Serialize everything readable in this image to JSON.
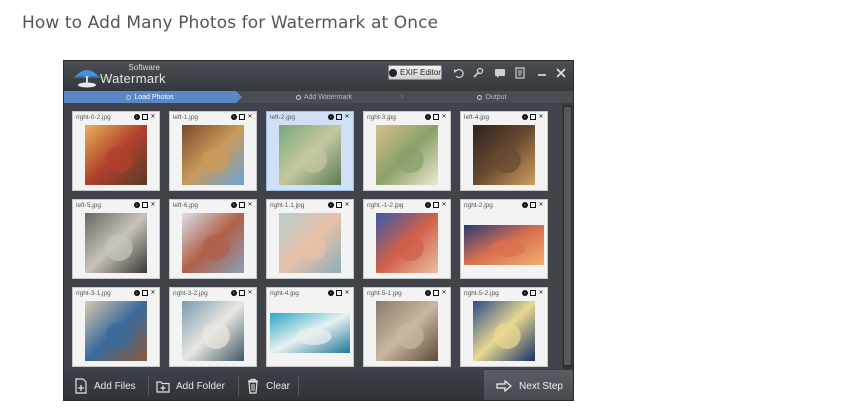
{
  "page": {
    "heading": "How to Add Many Photos for Watermark at Once"
  },
  "app": {
    "logo_small": "Software",
    "logo_big": "Watermark",
    "exif_label": "EXIF Editor",
    "titlebar_icons": [
      "undo-icon",
      "wrench-icon",
      "chat-icon",
      "document-icon",
      "minimize-icon",
      "close-icon"
    ],
    "steps": [
      {
        "label": "Load Photos",
        "active": true
      },
      {
        "label": "Add Watermark",
        "active": false
      },
      {
        "label": "Output",
        "active": false
      }
    ],
    "photos": [
      {
        "name": "right-0-2.jpg",
        "colors": [
          "#e8b25a",
          "#b0402c",
          "#5a3a2a"
        ],
        "selected": false
      },
      {
        "name": "left-1.jpg",
        "colors": [
          "#7a4a2a",
          "#c99a5a",
          "#6aa3d8"
        ],
        "selected": false
      },
      {
        "name": "left-2.jpg",
        "colors": [
          "#7aa87a",
          "#c4c8a0",
          "#5a7a5a"
        ],
        "selected": true
      },
      {
        "name": "right-3.jpg",
        "colors": [
          "#d8c08a",
          "#8aa06a",
          "#f0e8d0"
        ],
        "selected": false
      },
      {
        "name": "left-4.jpg",
        "colors": [
          "#2a2420",
          "#6a4a30",
          "#d0a060"
        ],
        "selected": false
      },
      {
        "name": "left-5.jpg",
        "colors": [
          "#6a6660",
          "#c8c4bc",
          "#3a3632"
        ],
        "selected": false
      },
      {
        "name": "left-6.jpg",
        "colors": [
          "#d8e0e8",
          "#b06048",
          "#88a0b8"
        ],
        "selected": false
      },
      {
        "name": "right-1.1.jpg",
        "colors": [
          "#b8ccd0",
          "#e8c0a8",
          "#8ab0b8"
        ],
        "selected": false
      },
      {
        "name": "right.-1-2.jpg",
        "colors": [
          "#3a5aa8",
          "#d06048",
          "#e8c0a0"
        ],
        "selected": false
      },
      {
        "name": "right-2.jpg",
        "colors": [
          "#2a3a78",
          "#d87050",
          "#f0b070"
        ],
        "selected": false
      },
      {
        "name": "right-3-1.jpg",
        "colors": [
          "#d8c8b0",
          "#3a6a9a",
          "#8a5a3a"
        ],
        "selected": false
      },
      {
        "name": "right-3-2.jpg",
        "colors": [
          "#7a9ab0",
          "#e8e8e0",
          "#405868"
        ],
        "selected": false
      },
      {
        "name": "right-4.jpg",
        "colors": [
          "#2aa8c8",
          "#e8f0f0",
          "#1a7898"
        ],
        "selected": false
      },
      {
        "name": "right-5-1.jpg",
        "colors": [
          "#8a7a6a",
          "#c8b8a0",
          "#5a4a3a"
        ],
        "selected": false
      },
      {
        "name": "right-5-2.jpg",
        "colors": [
          "#2a4a8a",
          "#e8d890",
          "#18306a"
        ],
        "selected": false
      }
    ],
    "bottom": {
      "add_files": "Add Files",
      "add_folder": "Add Folder",
      "clear": "Clear",
      "next_step": "Next Step"
    }
  }
}
